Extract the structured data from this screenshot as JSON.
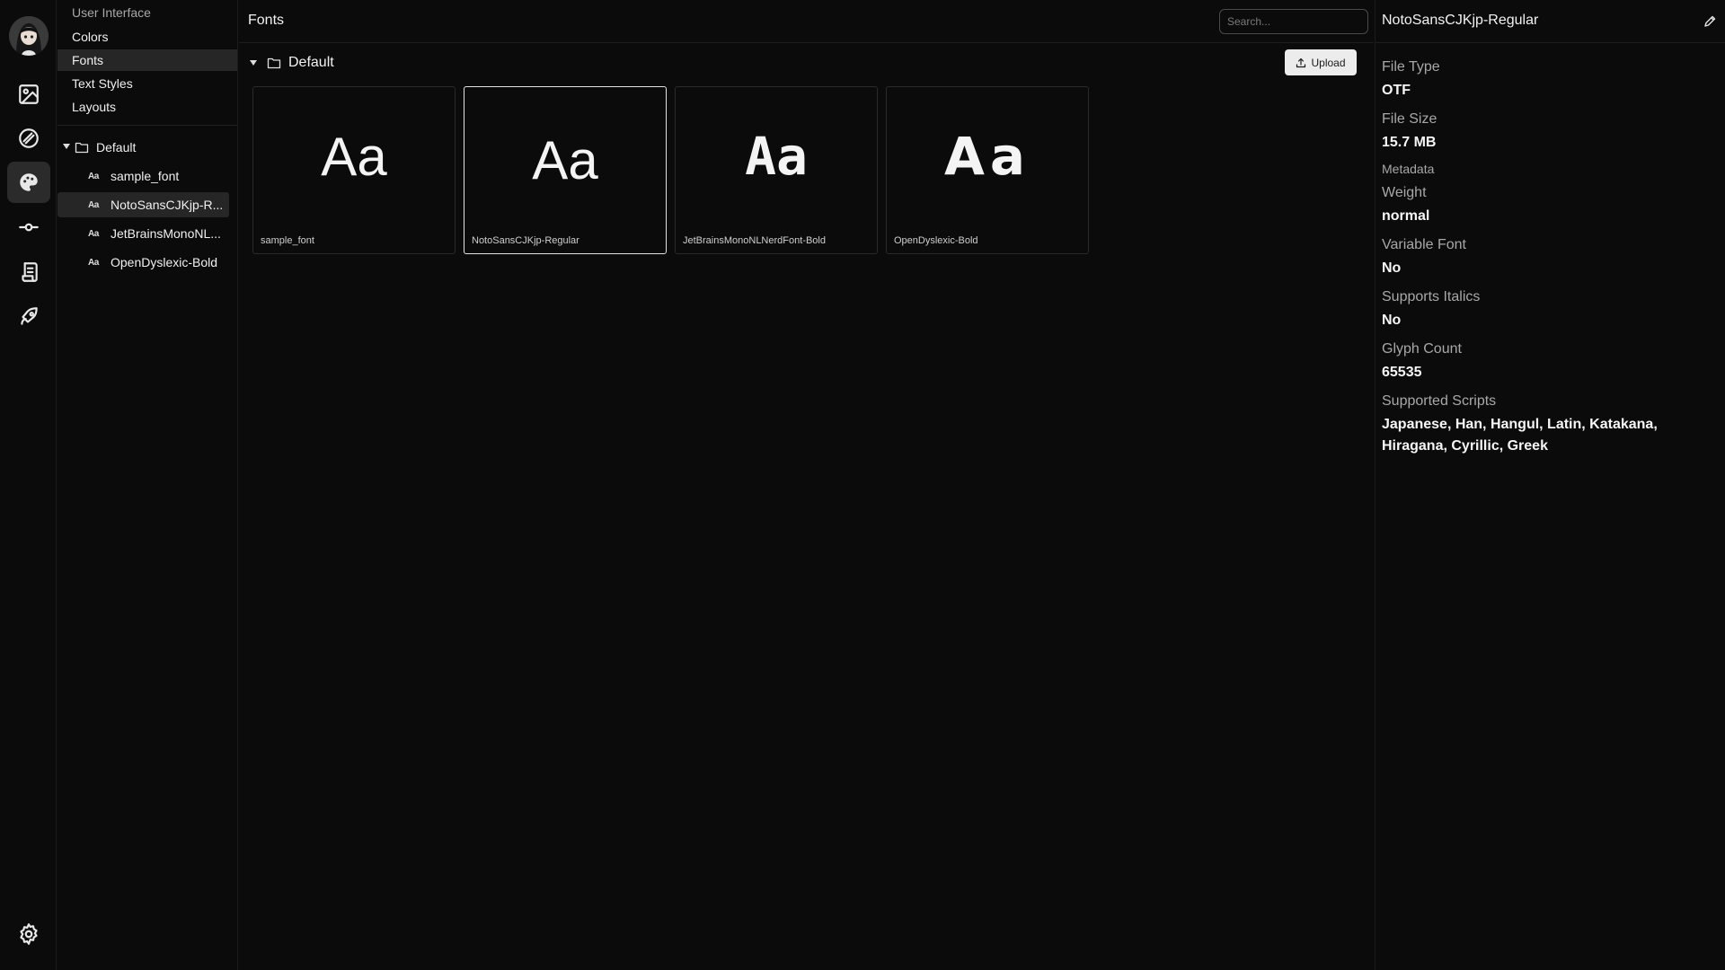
{
  "sidebar": {
    "section_title": "User Interface",
    "items": [
      {
        "label": "Colors"
      },
      {
        "label": "Fonts"
      },
      {
        "label": "Text Styles"
      },
      {
        "label": "Layouts"
      }
    ],
    "folder": "Default",
    "fonts": [
      {
        "label": "sample_font"
      },
      {
        "label": "NotoSansCJKjp-R..."
      },
      {
        "label": "JetBrainsMonoNL..."
      },
      {
        "label": "OpenDyslexic-Bold"
      }
    ]
  },
  "main": {
    "title": "Fonts",
    "search_placeholder": "Search...",
    "group": "Default",
    "upload_label": "Upload",
    "cards": [
      {
        "preview": "Aa",
        "name": "sample_font"
      },
      {
        "preview": "Aa",
        "name": "NotoSansCJKjp-Regular"
      },
      {
        "preview": "Aa",
        "name": "JetBrainsMonoNLNerdFont-Bold"
      },
      {
        "preview": "Aa",
        "name": "OpenDyslexic-Bold"
      }
    ]
  },
  "details": {
    "title": "NotoSansCJKjp-Regular",
    "file_type_label": "File Type",
    "file_type": "OTF",
    "file_size_label": "File Size",
    "file_size": "15.7 MB",
    "metadata_label": "Metadata",
    "weight_label": "Weight",
    "weight": "normal",
    "variable_label": "Variable Font",
    "variable": "No",
    "italics_label": "Supports Italics",
    "italics": "No",
    "glyph_label": "Glyph Count",
    "glyph": "65535",
    "scripts_label": "Supported Scripts",
    "scripts": "Japanese, Han, Hangul, Latin, Katakana, Hiragana, Cyrillic, Greek"
  },
  "colors": {
    "background": "#0b0b0b",
    "active_row": "#262626",
    "button_bg": "#ececec"
  }
}
